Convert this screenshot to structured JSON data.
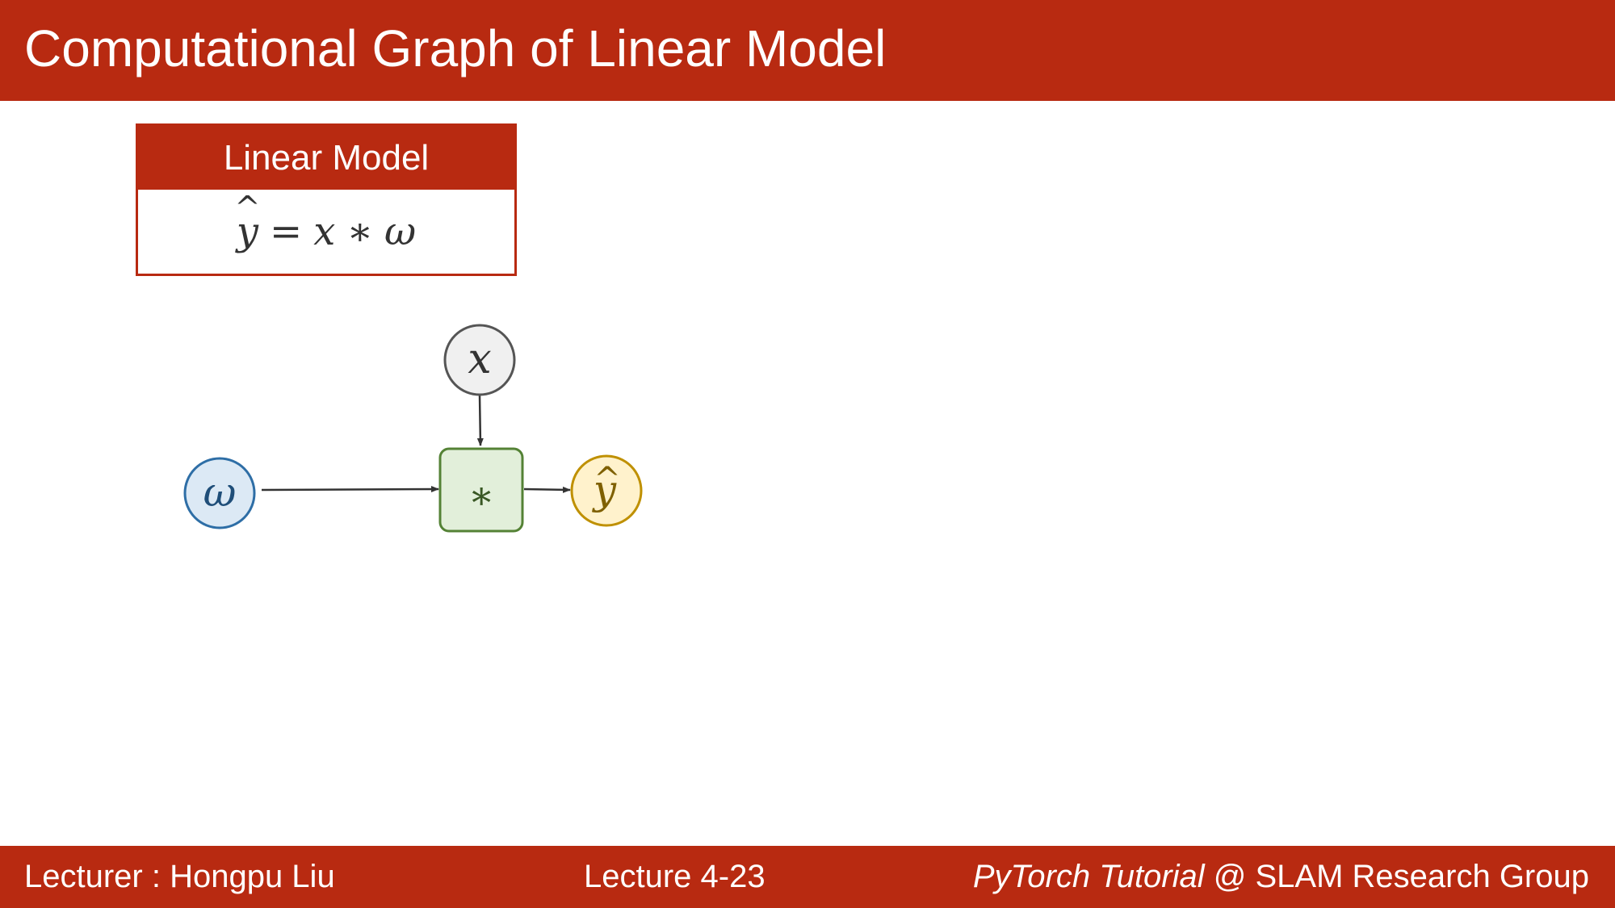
{
  "header": {
    "title": "Computational Graph of Linear Model"
  },
  "model_box": {
    "title": "Linear Model",
    "equation": {
      "lhs": "y",
      "lhs_accent": "^",
      "equals": "=",
      "x": "x",
      "times": "∗",
      "w": "ω"
    }
  },
  "graph": {
    "nodes": {
      "x": {
        "label": "x",
        "fill": "#f0f0f0",
        "stroke": "#555555"
      },
      "w": {
        "label": "ω",
        "fill": "#dce9f5",
        "stroke": "#2e6ea6"
      },
      "mul": {
        "label": "∗",
        "fill": "#e2efda",
        "stroke": "#548235"
      },
      "yhat": {
        "label": "y",
        "accent": "^",
        "fill": "#fff2cc",
        "stroke": "#bf9000"
      }
    },
    "edges": [
      {
        "from": "x",
        "to": "mul"
      },
      {
        "from": "w",
        "to": "mul"
      },
      {
        "from": "mul",
        "to": "yhat"
      }
    ]
  },
  "footer": {
    "lecturer": "Lecturer : Hongpu Liu",
    "lecture": "Lecture 4-23",
    "course": "PyTorch Tutorial",
    "group": " @ SLAM Research Group"
  },
  "colors": {
    "accent": "#b82a11"
  }
}
